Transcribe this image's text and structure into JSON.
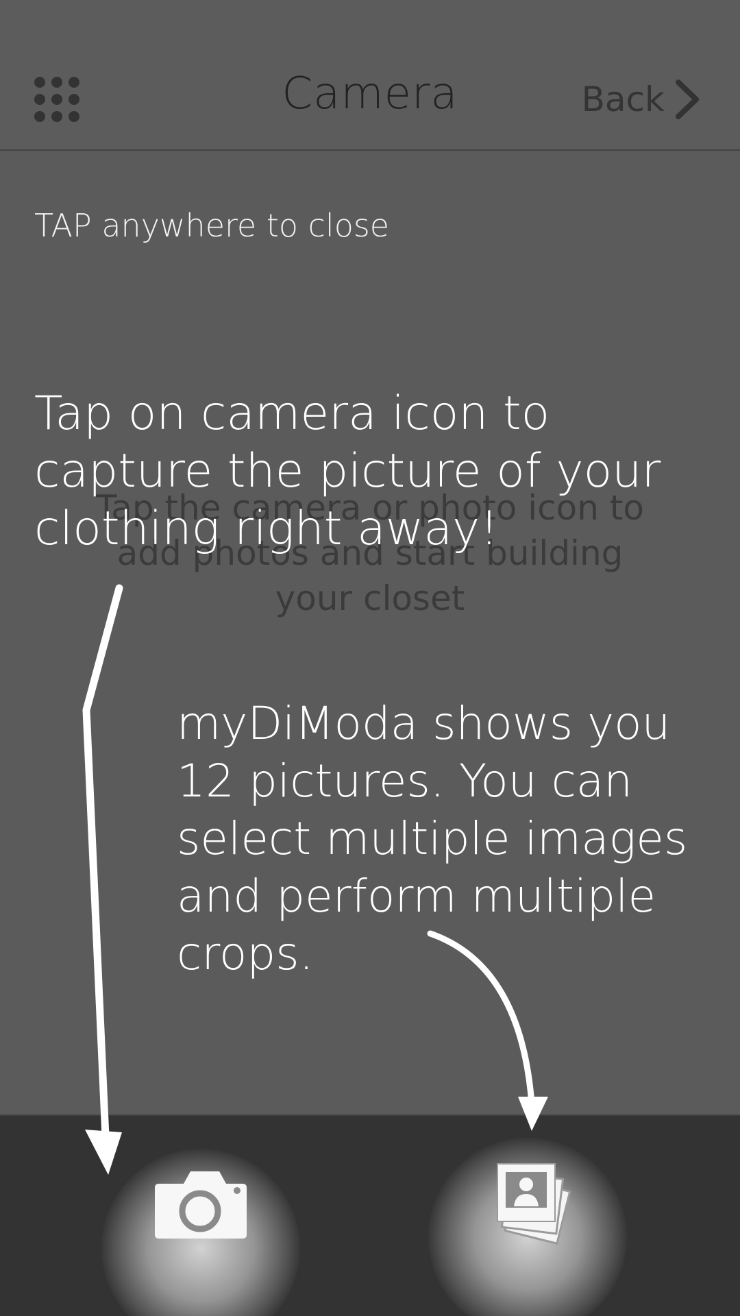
{
  "header": {
    "title": "Camera",
    "back_label": "Back",
    "menu_icon": "grid-menu-icon",
    "back_icon": "chevron-right-icon"
  },
  "main": {
    "empty_message": "Tap the camera or photo icon to\nadd photos and start building\nyour closet"
  },
  "overlay": {
    "close_hint": "TAP anywhere to close",
    "camera_tip": "Tap on camera icon to capture the picture of your clothing right away!",
    "photos_tip": "myDiModa shows you 12 pictures. You can select multiple images and perform multiple crops."
  },
  "bottom_bar": {
    "camera_icon": "camera-icon",
    "photos_icon": "photo-stack-icon"
  },
  "colors": {
    "overlay_background": "#5b5b5b",
    "bottom_bar": "#333333",
    "tip_text": "#ffffff"
  }
}
